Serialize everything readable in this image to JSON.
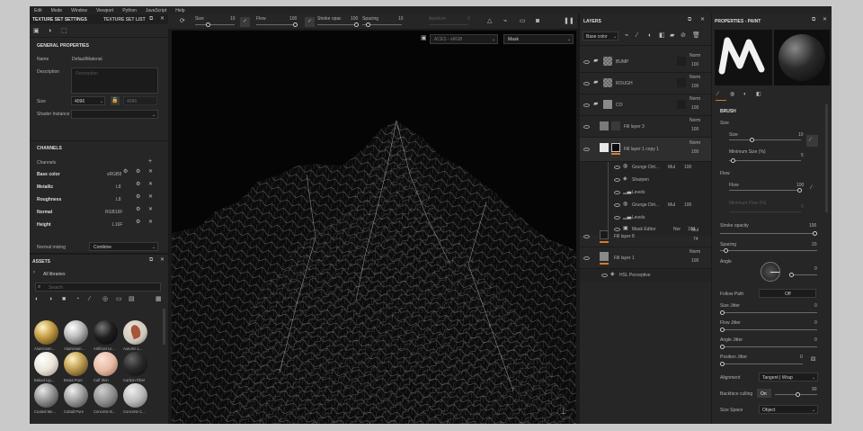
{
  "menu": [
    "Edit",
    "Mode",
    "Window",
    "Viewport",
    "Python",
    "JavaScript",
    "Help"
  ],
  "toolbar": {
    "size_label": "Size",
    "size_val": "10",
    "flow_label": "Flow",
    "flow_val": "100",
    "stroke_label": "Stroke opac",
    "stroke_val": "100",
    "spacing_label": "Spacing",
    "spacing_val": "10",
    "aperture_label": "Aperture",
    "aperture_val": "0"
  },
  "tss": {
    "tab1": "TEXTURE SET SETTINGS",
    "tab2": "TEXTURE SET LIST",
    "general": "GENERAL PROPERTIES",
    "name_label": "Name",
    "name_val": "DefaultMaterial",
    "desc_label": "Description",
    "desc_placeholder": "Description",
    "size_label": "Size",
    "size_val": "4096",
    "size_val2": "4096",
    "shader_label": "Shader Instance",
    "channels_title": "CHANNELS",
    "channels_label": "Channels",
    "channels": [
      {
        "name": "Base color",
        "fmt": "sRGB8"
      },
      {
        "name": "Metallic",
        "fmt": "L8"
      },
      {
        "name": "Roughness",
        "fmt": "L8"
      },
      {
        "name": "Normal",
        "fmt": "RGB16F"
      },
      {
        "name": "Height",
        "fmt": "L16F"
      }
    ],
    "normal_mixing_label": "Normal mixing",
    "normal_mixing_val": "Combine"
  },
  "assets": {
    "title": "ASSETS",
    "all_libraries": "All libraries",
    "search_placeholder": "Search",
    "items": [
      {
        "label": "Aluminium...",
        "color": "#c9a24a"
      },
      {
        "label": "Aluminium...",
        "color": "#bdbdbd"
      },
      {
        "label": "Artificial Le...",
        "color": "#1e1e1e"
      },
      {
        "label": "Autumn L...",
        "color": "#a8553a"
      },
      {
        "label": "Baked Lig...",
        "color": "#e9e2d8"
      },
      {
        "label": "Brass Pure",
        "color": "#c6a45a"
      },
      {
        "label": "Calf Skin",
        "color": "#e6b9a4"
      },
      {
        "label": "Carbon Fiber",
        "color": "#2a2a2a"
      },
      {
        "label": "Coated Me...",
        "color": "#9c9c9c"
      },
      {
        "label": "Cobalt Pure",
        "color": "#a8a8a8"
      },
      {
        "label": "Concrete B...",
        "color": "#8d8d8d"
      },
      {
        "label": "Concrete C...",
        "color": "#b9b9b9"
      }
    ]
  },
  "viewport": {
    "display_select": "ACES - sRGB",
    "mode_select": "Mask"
  },
  "layers": {
    "title": "LAYERS",
    "channel_select": "Base color",
    "items": [
      {
        "name": "BUMP",
        "blend": "Norm",
        "opacity": "100"
      },
      {
        "name": "ROUGH",
        "blend": "Norm",
        "opacity": "100"
      },
      {
        "name": "CO",
        "blend": "Norm",
        "opacity": "100"
      },
      {
        "name": "Fill layer 3",
        "blend": "Norm",
        "opacity": "100"
      },
      {
        "name": "Fill layer 1 copy 1",
        "blend": "Norm",
        "opacity": "100"
      }
    ],
    "effects": [
      {
        "name": "Grunge Dirt...",
        "blend": "Mul",
        "opacity": "100"
      },
      {
        "name": "Sharpen",
        "blend": "",
        "opacity": ""
      },
      {
        "name": "Levels",
        "blend": "",
        "opacity": ""
      },
      {
        "name": "Grunge Dirt...",
        "blend": "Mul",
        "opacity": "100"
      },
      {
        "name": "Levels",
        "blend": "",
        "opacity": ""
      },
      {
        "name": "Mask Editor",
        "blend": "Nor",
        "opacity": "100"
      }
    ],
    "lower": [
      {
        "name": "Fill layer 8",
        "blend": "Mul",
        "opacity": "74"
      },
      {
        "name": "Fill layer 1",
        "blend": "Norm",
        "opacity": "100"
      }
    ],
    "hsl": "HSL Perceptive"
  },
  "props": {
    "title": "PROPERTIES - PAINT",
    "brush": "BRUSH",
    "size_section": "Size",
    "size_label": "Size",
    "size_val": "10",
    "min_size_label": "Minimum Size (%)",
    "min_size_val": "5",
    "flow_section": "Flow",
    "flow_label": "Flow",
    "flow_val": "100",
    "min_flow_label": "Minimum Flow (%)",
    "min_flow_val": "0",
    "stroke_label": "Stroke opacity",
    "stroke_val": "100",
    "spacing_label": "Spacing",
    "spacing_val": "20",
    "angle_label": "Angle",
    "angle_val": "0",
    "follow_label": "Follow Path",
    "follow_val": "Off",
    "size_jitter": "Size Jitter",
    "size_jitter_val": "0",
    "flow_jitter": "Flow Jitter",
    "flow_jitter_val": "0",
    "angle_jitter": "Angle Jitter",
    "angle_jitter_val": "0",
    "pos_jitter": "Position Jitter",
    "pos_jitter_val": "0",
    "alignment_label": "Alignment",
    "alignment_val": "Tangent | Wrap",
    "backface_label": "Backface culling",
    "backface_val": "On",
    "backface_num": "90",
    "space_label": "Size Space",
    "space_val": "Object"
  }
}
